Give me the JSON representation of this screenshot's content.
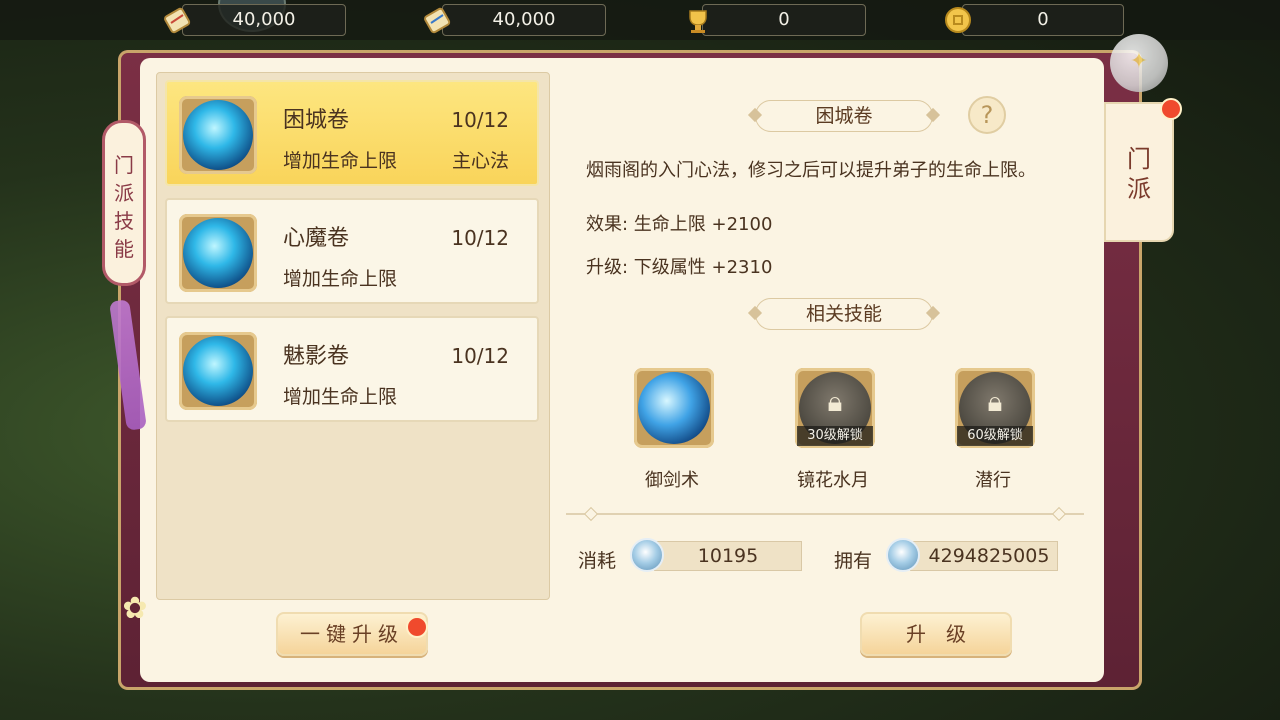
{
  "top_resources": [
    {
      "icon": "scroll-icon",
      "value": "40,000"
    },
    {
      "icon": "scroll-icon",
      "value": "40,000"
    },
    {
      "icon": "trophy-icon",
      "value": "0"
    },
    {
      "icon": "coin-icon",
      "value": "0"
    }
  ],
  "left_tab": {
    "label": "门派技能"
  },
  "right_tab": {
    "label": "门派"
  },
  "skills": [
    {
      "name": "困城卷",
      "desc": "增加生命上限",
      "level": "10/12",
      "tag": "主心法",
      "selected": true
    },
    {
      "name": "心魔卷",
      "desc": "增加生命上限",
      "level": "10/12",
      "tag": "",
      "selected": false
    },
    {
      "name": "魅影卷",
      "desc": "增加生命上限",
      "level": "10/12",
      "tag": "",
      "selected": false
    }
  ],
  "detail": {
    "title": "困城卷",
    "help": "?",
    "intro": "烟雨阁的入门心法，修习之后可以提升弟子的生命上限。",
    "effect": "效果: 生命上限 +2100",
    "upgrade": "升级: 下级属性 +2310",
    "related_title": "相关技能",
    "related": [
      {
        "name": "御剑术",
        "locked": false,
        "unlock": ""
      },
      {
        "name": "镜花水月",
        "locked": true,
        "unlock": "30级解锁"
      },
      {
        "name": "潜行",
        "locked": true,
        "unlock": "60级解锁"
      }
    ]
  },
  "cost": {
    "label": "消耗",
    "value": "10195"
  },
  "own": {
    "label": "拥有",
    "value": "4294825005"
  },
  "buttons": {
    "one_key": "一键升级",
    "upgrade": "升级"
  },
  "colors": {
    "frame": "#7b2f45",
    "panel": "#fbf4e3",
    "selected": "#f9d45a",
    "badge": "#f04a2d"
  }
}
